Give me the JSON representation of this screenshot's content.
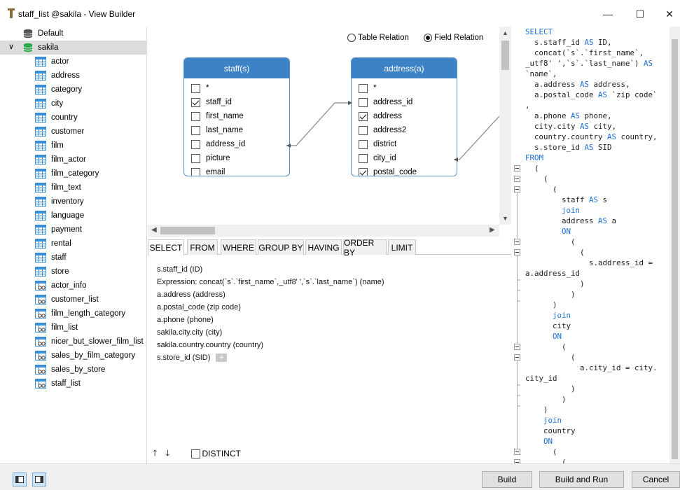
{
  "window": {
    "title": "staff_list @sakila - View Builder",
    "minimize_glyph": "—",
    "maximize_glyph": "☐",
    "close_glyph": "✕"
  },
  "tree": {
    "expand_glyph": "∨",
    "items": [
      {
        "label": "Default",
        "icon": "database-gray-icon",
        "level": 0
      },
      {
        "label": "sakila",
        "icon": "database-green-icon",
        "level": 0,
        "selected": true
      },
      {
        "label": "actor",
        "icon": "table-icon",
        "level": 1
      },
      {
        "label": "address",
        "icon": "table-icon",
        "level": 1
      },
      {
        "label": "category",
        "icon": "table-icon",
        "level": 1
      },
      {
        "label": "city",
        "icon": "table-icon",
        "level": 1
      },
      {
        "label": "country",
        "icon": "table-icon",
        "level": 1
      },
      {
        "label": "customer",
        "icon": "table-icon",
        "level": 1
      },
      {
        "label": "film",
        "icon": "table-icon",
        "level": 1
      },
      {
        "label": "film_actor",
        "icon": "table-icon",
        "level": 1
      },
      {
        "label": "film_category",
        "icon": "table-icon",
        "level": 1
      },
      {
        "label": "film_text",
        "icon": "table-icon",
        "level": 1
      },
      {
        "label": "inventory",
        "icon": "table-icon",
        "level": 1
      },
      {
        "label": "language",
        "icon": "table-icon",
        "level": 1
      },
      {
        "label": "payment",
        "icon": "table-icon",
        "level": 1
      },
      {
        "label": "rental",
        "icon": "table-icon",
        "level": 1
      },
      {
        "label": "staff",
        "icon": "table-icon",
        "level": 1
      },
      {
        "label": "store",
        "icon": "table-icon",
        "level": 1
      },
      {
        "label": "actor_info",
        "icon": "view-icon",
        "level": 1
      },
      {
        "label": "customer_list",
        "icon": "view-icon",
        "level": 1
      },
      {
        "label": "film_length_category",
        "icon": "view-icon",
        "level": 1
      },
      {
        "label": "film_list",
        "icon": "view-icon",
        "level": 1
      },
      {
        "label": "nicer_but_slower_film_list",
        "icon": "view-icon",
        "level": 1
      },
      {
        "label": "sales_by_film_category",
        "icon": "view-icon",
        "level": 1
      },
      {
        "label": "sales_by_store",
        "icon": "view-icon",
        "level": 1
      },
      {
        "label": "staff_list",
        "icon": "view-icon",
        "level": 1
      }
    ]
  },
  "canvas": {
    "relation_modes": {
      "table": "Table Relation",
      "field": "Field Relation",
      "selected": "field"
    },
    "tables": [
      {
        "title": "staff(s)",
        "fields": [
          {
            "name": "*",
            "checked": false
          },
          {
            "name": "staff_id",
            "checked": true
          },
          {
            "name": "first_name",
            "checked": false
          },
          {
            "name": "last_name",
            "checked": false
          },
          {
            "name": "address_id",
            "checked": false
          },
          {
            "name": "picture",
            "checked": false
          },
          {
            "name": "email",
            "checked": false
          }
        ]
      },
      {
        "title": "address(a)",
        "fields": [
          {
            "name": "*",
            "checked": false
          },
          {
            "name": "address_id",
            "checked": false
          },
          {
            "name": "address",
            "checked": true
          },
          {
            "name": "address2",
            "checked": false
          },
          {
            "name": "district",
            "checked": false
          },
          {
            "name": "city_id",
            "checked": false
          },
          {
            "name": "postal_code",
            "checked": true
          }
        ]
      }
    ]
  },
  "clause_tabs": [
    "SELECT",
    "FROM",
    "WHERE",
    "GROUP BY",
    "HAVING",
    "ORDER BY",
    "LIMIT"
  ],
  "active_tab": "SELECT",
  "select_items": [
    "s.staff_id (ID)",
    "Expression: concat(`s`.`first_name`,_utf8' ',`s`.`last_name`) (name)",
    "a.address (address)",
    "a.postal_code (zip code)",
    "a.phone (phone)",
    "sakila.city.city (city)",
    "sakila.country.country (country)",
    "s.store_id (SID)"
  ],
  "add_glyph": "+",
  "move_up_glyph": "🡑",
  "move_down_glyph": "🡓",
  "distinct_label": "DISTINCT",
  "sql_lines": [
    "SELECT",
    "  s.staff_id AS ID,",
    "  concat(`s`.`first_name`,",
    "_utf8' ',`s`.`last_name`) AS",
    "`name`,",
    "  a.address AS address,",
    "  a.postal_code AS `zip code`",
    ",",
    "  a.phone AS phone,",
    "  city.city AS city,",
    "  country.country AS country,",
    "  s.store_id AS SID",
    "FROM",
    "  (",
    "    (",
    "      (",
    "        staff AS s",
    "        join",
    "        address AS a",
    "        ON",
    "          (",
    "            (",
    "              s.address_id =",
    "a.address_id",
    "            )",
    "          )",
    "      )",
    "      join",
    "      city",
    "      ON",
    "        (",
    "          (",
    "            a.city_id = city.",
    "city_id",
    "          )",
    "        )",
    "    )",
    "    join",
    "    country",
    "    ON",
    "      (",
    "        ("
  ],
  "sql_keywords": [
    "SELECT",
    "FROM",
    "AS",
    "join",
    "ON"
  ],
  "footer": {
    "build": "Build",
    "build_and_run": "Build and Run",
    "cancel": "Cancel"
  },
  "colors": {
    "accent": "#3d82c4",
    "keyword": "#1c6fd6"
  }
}
